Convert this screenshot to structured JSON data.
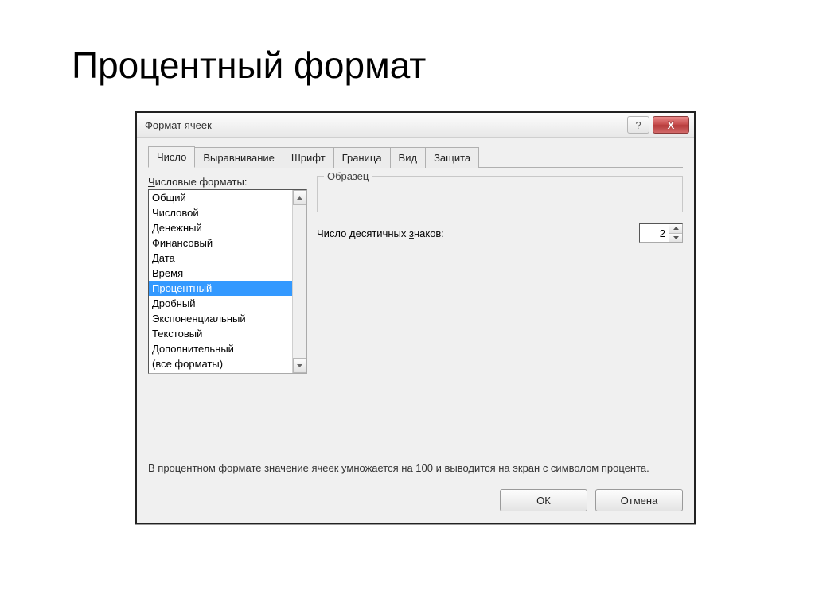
{
  "slide_title": "Процентный формат",
  "dialog": {
    "title": "Формат ячеек",
    "help_glyph": "?",
    "close_glyph": "X"
  },
  "tabs": [
    {
      "label": "Число",
      "active": true
    },
    {
      "label": "Выравнивание",
      "active": false
    },
    {
      "label": "Шрифт",
      "active": false
    },
    {
      "label": "Граница",
      "active": false
    },
    {
      "label": "Вид",
      "active": false
    },
    {
      "label": "Защита",
      "active": false
    }
  ],
  "formats_label_pre": "Ч",
  "formats_label_rest": "исловые форматы:",
  "format_list": [
    "Общий",
    "Числовой",
    "Денежный",
    "Финансовый",
    "Дата",
    "Время",
    "Процентный",
    "Дробный",
    "Экспоненциальный",
    "Текстовый",
    "Дополнительный",
    "(все форматы)"
  ],
  "selected_format_index": 6,
  "sample_label": "Образец",
  "sample_value": "",
  "decimal_label_pre": "Число десятичных ",
  "decimal_label_u": "з",
  "decimal_label_post": "наков:",
  "decimal_value": "2",
  "description": "В процентном формате значение ячеек умножается на 100 и выводится на экран с символом процента.",
  "buttons": {
    "ok": "ОК",
    "cancel": "Отмена"
  }
}
